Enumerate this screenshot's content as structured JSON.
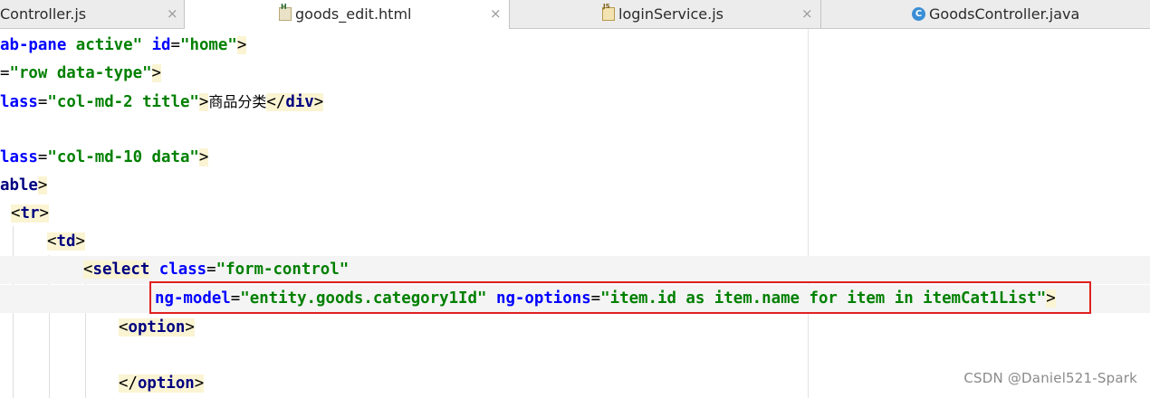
{
  "tabs": [
    {
      "label": "Controller.js",
      "icon": "none",
      "active": false
    },
    {
      "label": "goods_edit.html",
      "icon": "html-file-icon",
      "active": true
    },
    {
      "label": "loginService.js",
      "icon": "js-file-icon",
      "active": false
    },
    {
      "label": "GoodsController.java",
      "icon": "java-class-icon",
      "active": false
    }
  ],
  "close_glyph": "×",
  "class_icon_letter": "C",
  "code": {
    "l1": [
      "ab-pane",
      " ",
      "active",
      "\"",
      " ",
      "id",
      "=",
      "\"home\"",
      ">"
    ],
    "l2": [
      "=",
      "\"row data-type\"",
      ">"
    ],
    "l3": [
      "lass",
      "=",
      "\"col-md-2 title\"",
      ">",
      "商品分类",
      "</",
      "div",
      ">"
    ],
    "l5": [
      "lass",
      "=",
      "\"col-md-10 data\"",
      ">"
    ],
    "l6": [
      "able",
      ">"
    ],
    "l7": [
      "<",
      "tr",
      ">"
    ],
    "l8": [
      "<",
      "td",
      ">"
    ],
    "l9": [
      "<",
      "select",
      " ",
      "class",
      "=",
      "\"form-control\""
    ],
    "l10": [
      "ng-model",
      "=",
      "\"entity.goods.category1Id\"",
      " ",
      "ng-options",
      "=",
      "\"item.id as item.name for item in itemCat1List\"",
      ">"
    ],
    "l11": [
      "<",
      "option",
      ">"
    ],
    "l13": [
      "</",
      "option",
      ">"
    ]
  },
  "watermark": "CSDN @Daniel521-Spark",
  "colors": {
    "tag": "#000080",
    "attribute": "#0000ff",
    "string": "#008000",
    "highlight_box": "#e02020"
  }
}
